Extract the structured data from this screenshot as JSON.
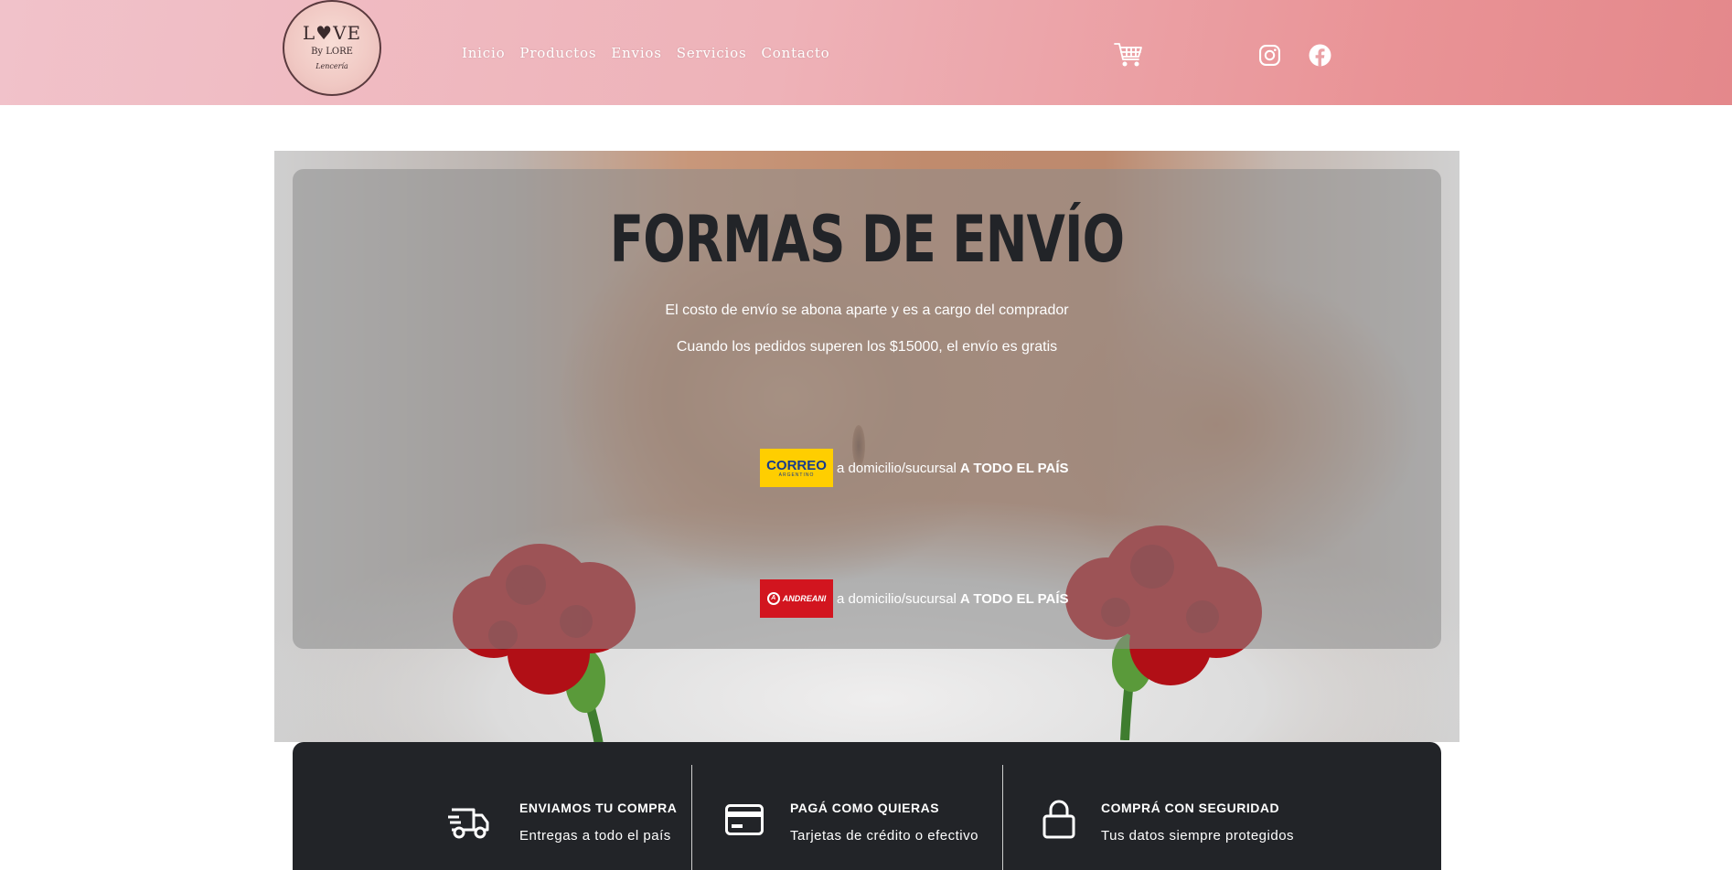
{
  "header": {
    "logo": {
      "line1": "L♥VE",
      "line2": "By LORE",
      "line3": "Lencería"
    },
    "nav": [
      "Inicio",
      "Productos",
      "Envios",
      "Servicios",
      "Contacto"
    ],
    "icons": {
      "cart": "cart-icon",
      "instagram": "instagram-icon",
      "facebook": "facebook-icon"
    },
    "colors": {
      "gradient_start": "#f1c2ca",
      "gradient_end": "#e4888b"
    }
  },
  "hero": {
    "title": "FORMAS DE ENVÍO",
    "line1": "El costo de envío se abona aparte y es a cargo del comprador",
    "line2": "Cuando los pedidos superen los $15000, el envío es gratis",
    "carriers": [
      {
        "logo_main": "CORREO",
        "logo_sub": "ARGENTINO",
        "text": "a domicilio/sucursal",
        "emphasis": "A TODO EL PAÍS",
        "color": "#ffce00"
      },
      {
        "logo_main": "ANDREANI",
        "text": "a domicilio/sucursal",
        "emphasis": "A TODO EL PAÍS",
        "color": "#d2151f"
      }
    ]
  },
  "features": [
    {
      "icon": "truck-icon",
      "title": "ENVIAMOS TU COMPRA",
      "subtitle": "Entregas a todo el país"
    },
    {
      "icon": "credit-card-icon",
      "title": "PAGÁ COMO QUIERAS",
      "subtitle": "Tarjetas de crédito o efectivo"
    },
    {
      "icon": "lock-icon",
      "title": "COMPRÁ CON SEGURIDAD",
      "subtitle": "Tus datos siempre protegidos"
    }
  ]
}
